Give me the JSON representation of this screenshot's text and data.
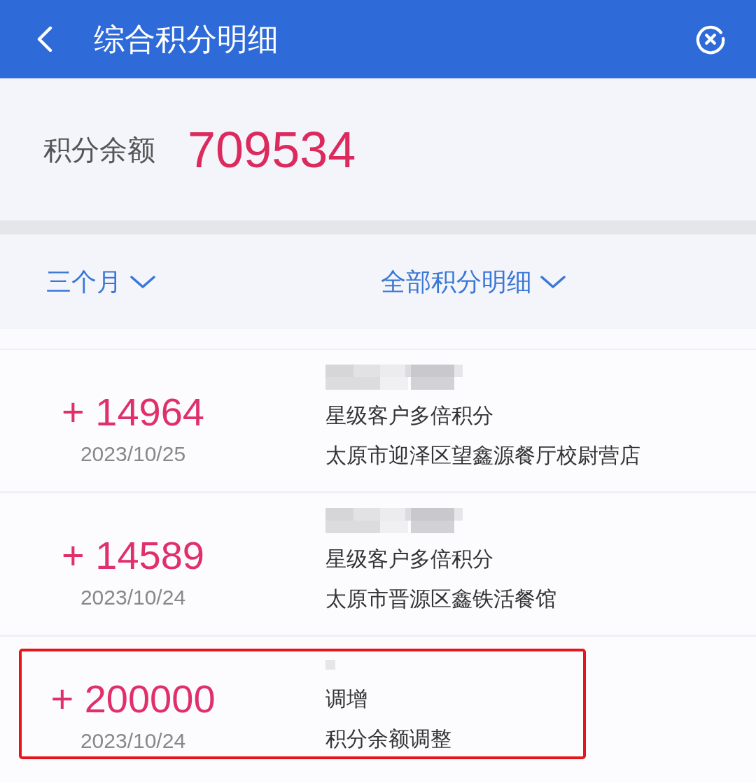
{
  "header": {
    "title": "综合积分明细"
  },
  "balance": {
    "label": "积分余额",
    "value": "709534"
  },
  "filters": [
    {
      "label": "三个月"
    },
    {
      "label": "全部积分明细"
    }
  ],
  "records": [
    {
      "kind": "purchase",
      "amount": "+ 14964",
      "date": "2023/10/25",
      "type": "星级客户多倍积分",
      "merchant": "太原市迎泽区望鑫源餐厅校尉营店",
      "highlighted": false
    },
    {
      "kind": "purchase",
      "amount": "+ 14589",
      "date": "2023/10/24",
      "type": "星级客户多倍积分",
      "merchant": "太原市晋源区鑫铁活餐馆",
      "highlighted": false
    },
    {
      "kind": "adjustment",
      "amount": "+ 200000",
      "date": "2023/10/24",
      "type": "调增",
      "merchant": "积分余额调整",
      "highlighted": true
    }
  ]
}
